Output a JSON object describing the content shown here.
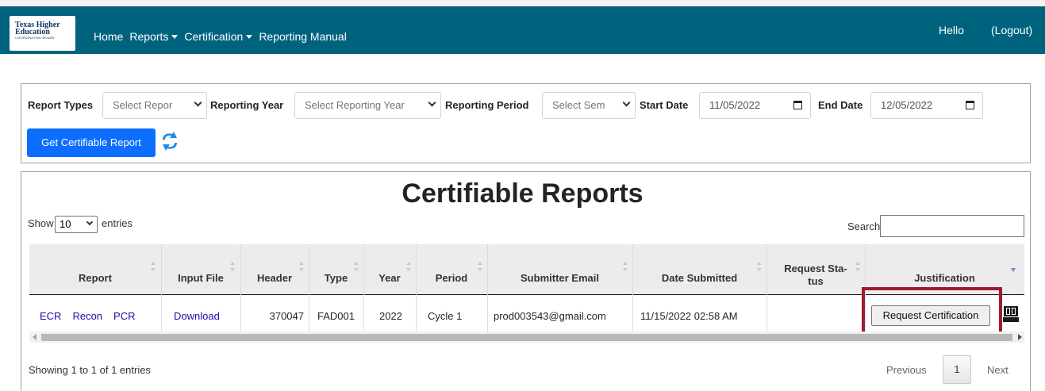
{
  "colors": {
    "navbar": "#00637e",
    "primary": "#0d6efd",
    "highlight": "#9e1b32",
    "link": "#1a0dab"
  },
  "logo": {
    "line1": "Texas Higher",
    "line2": "Education",
    "line3": "COORDINATING BOARD"
  },
  "nav": {
    "home": "Home",
    "reports": "Reports",
    "certification": "Certification",
    "manual": "Reporting Manual",
    "hello": "Hello",
    "logout": "(Logout)"
  },
  "filters": {
    "report_types_label": "Report Types",
    "report_types_value": "Select Repor",
    "reporting_year_label": "Reporting Year",
    "reporting_year_value": "Select Reporting Year",
    "reporting_period_label": "Reporting Period",
    "reporting_period_value": "Select Sem",
    "start_date_label": "Start Date",
    "start_date_value": "11/05/2022",
    "end_date_label": "End Date",
    "end_date_value": "12/05/2022",
    "get_button": "Get Certifiable Report",
    "refresh_icon": "refresh-icon"
  },
  "table_section": {
    "title": "Certifiable Reports",
    "show_label": "Show",
    "page_length": "10",
    "entries_label": "entries",
    "search_label": "Search:",
    "search_value": ""
  },
  "columns": [
    "Report",
    "Input File",
    "Header",
    "Type",
    "Year",
    "Period",
    "Submitter Email",
    "Date Submitted",
    "Request Status",
    "Justification"
  ],
  "column_display": {
    "request_status_line1": "Request Sta-",
    "request_status_line2": "tus"
  },
  "rows": [
    {
      "report_links": [
        "ECR",
        "Recon",
        "PCR"
      ],
      "input_file": "Download",
      "header": "370047",
      "type": "FAD001",
      "year": "2022",
      "period": "Cycle 1",
      "email": "prod003543@gmail.com",
      "date_submitted": "11/15/2022 02:58 AM",
      "request_status": "",
      "action_button": "Request Certification",
      "history_icon": "history-icon"
    }
  ],
  "footer": {
    "info": "Showing 1 to 1 of 1 entries",
    "previous": "Previous",
    "page": "1",
    "next": "Next"
  }
}
